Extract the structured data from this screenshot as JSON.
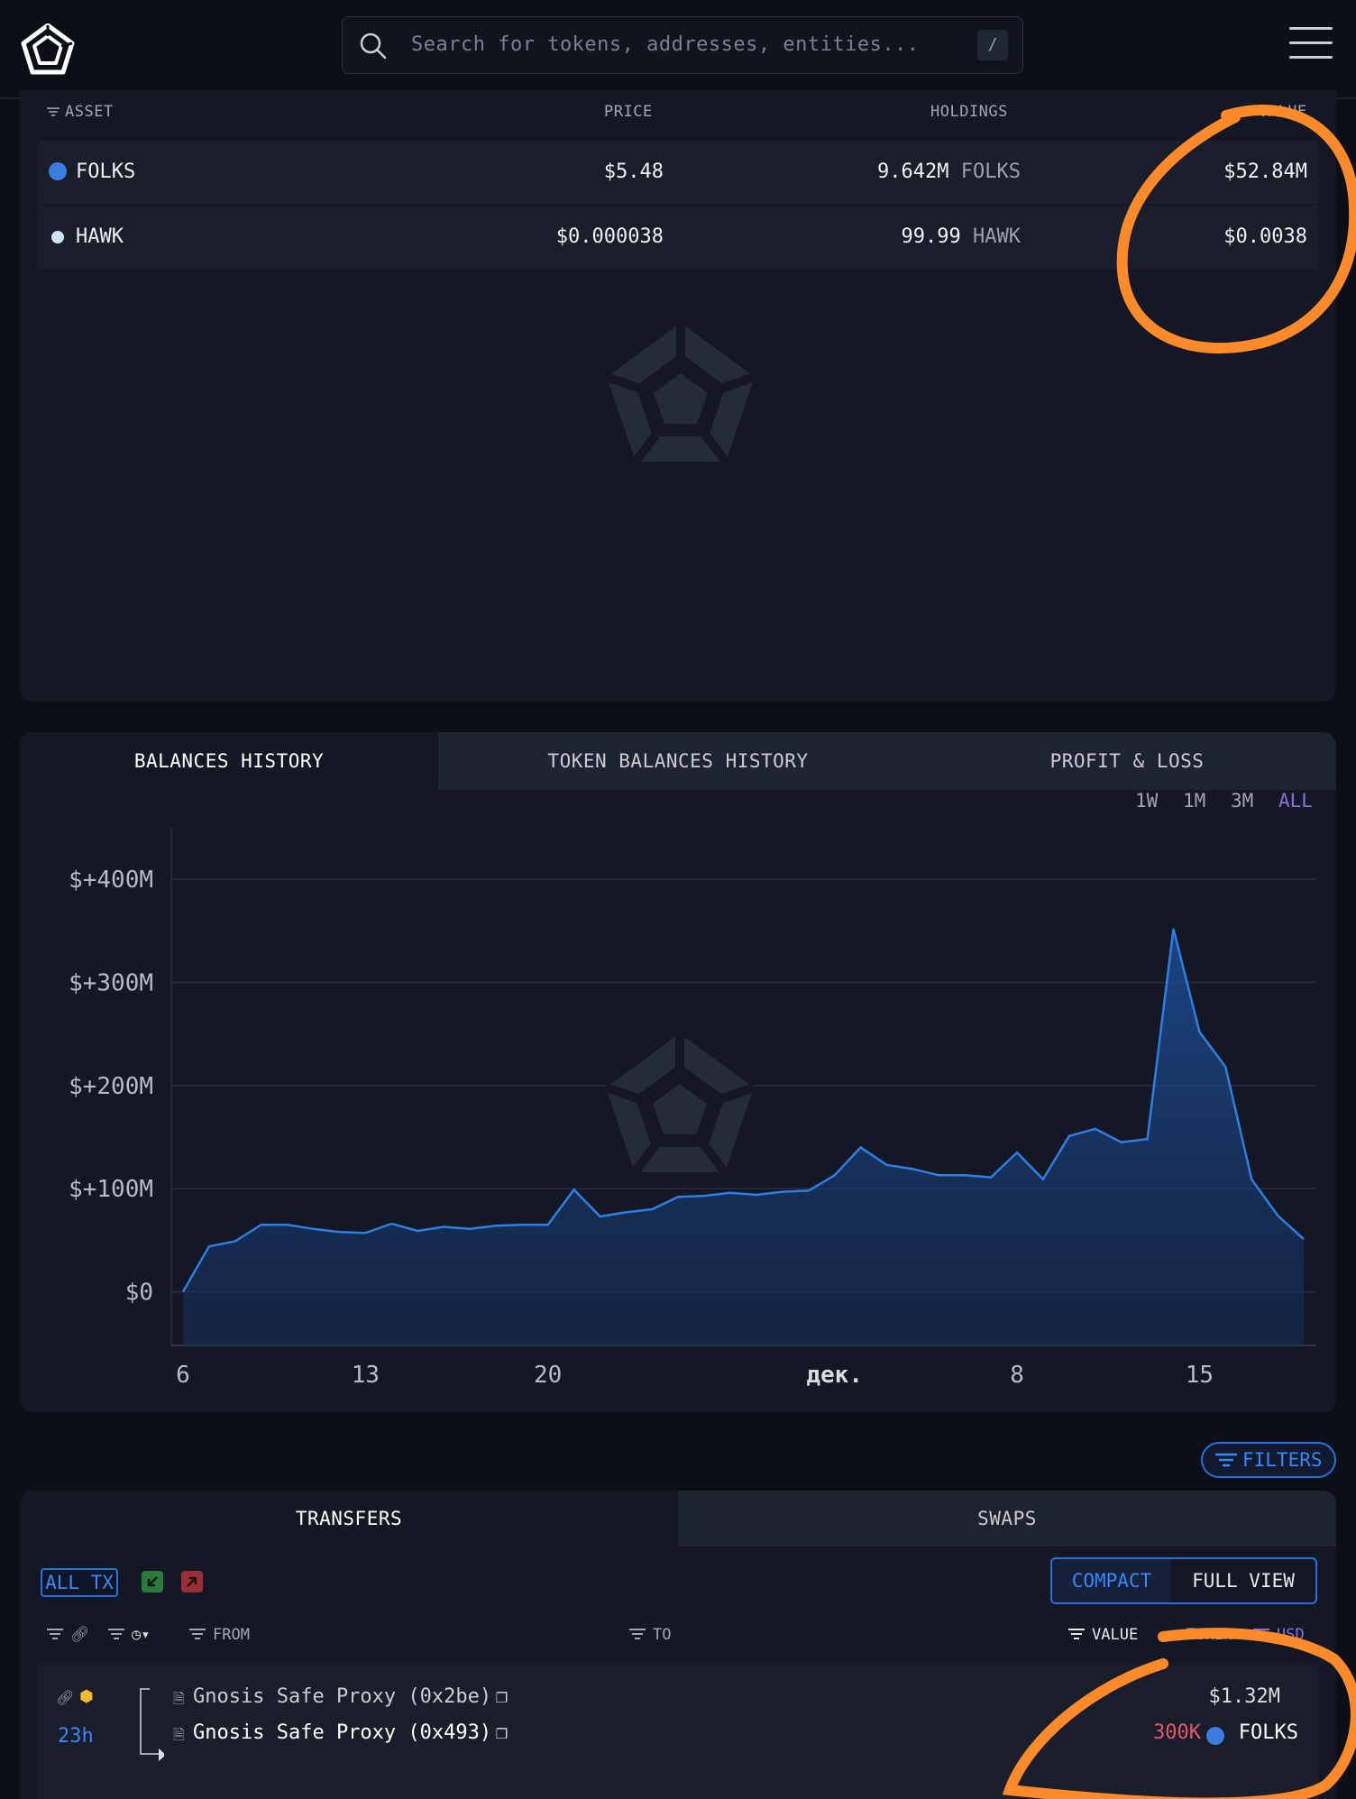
{
  "search": {
    "placeholder": "Search for tokens, addresses, entities...",
    "shortcut": "/"
  },
  "holdings": {
    "columns": {
      "asset": "ASSET",
      "price": "PRICE",
      "holdings": "HOLDINGS",
      "value": "VALUE"
    },
    "rows": [
      {
        "asset": "FOLKS",
        "price": "$5.48",
        "amount": "9.642M",
        "unit": "FOLKS",
        "value": "$52.84M",
        "color": "#3b7ddd"
      },
      {
        "asset": "HAWK",
        "price": "$0.000038",
        "amount": "99.99",
        "unit": "HAWK",
        "value": "$0.0038",
        "color": "#5aa0d8"
      }
    ]
  },
  "history": {
    "tabs": [
      "BALANCES HISTORY",
      "TOKEN BALANCES HISTORY",
      "PROFIT & LOSS"
    ],
    "ranges": [
      "1W",
      "1M",
      "3M",
      "ALL"
    ],
    "active_range": "ALL"
  },
  "chart_data": {
    "type": "area",
    "yticks": [
      "$+400M",
      "$+300M",
      "$+200M",
      "$+100M",
      "$0"
    ],
    "ylim": [
      -52,
      400
    ],
    "xticks": [
      {
        "label": "6",
        "x": 0
      },
      {
        "label": "13",
        "x": 7
      },
      {
        "label": "20",
        "x": 14
      },
      {
        "label": "дек.",
        "x": 25
      },
      {
        "label": "8",
        "x": 32
      },
      {
        "label": "15",
        "x": 39
      }
    ],
    "x": [
      0,
      1,
      2,
      3,
      4,
      5,
      6,
      7,
      8,
      9,
      10,
      11,
      12,
      13,
      14,
      15,
      16,
      17,
      18,
      19,
      20,
      21,
      22,
      23,
      24,
      25,
      26,
      27,
      28,
      29,
      30,
      31,
      32,
      33,
      34,
      35,
      36,
      37,
      38,
      39,
      40,
      41,
      42,
      43
    ],
    "values": [
      0,
      44,
      49,
      65,
      65,
      61,
      58,
      57,
      66,
      59,
      63,
      61,
      64,
      65,
      65,
      99,
      73,
      77,
      80,
      92,
      93,
      96,
      94,
      97,
      98,
      113,
      140,
      123,
      119,
      113,
      113,
      111,
      135,
      109,
      151,
      158,
      145,
      148,
      352,
      252,
      218,
      109,
      74,
      51,
      53
    ],
    "color": "#2f7fe3"
  },
  "filters_label": "FILTERS",
  "transfers": {
    "tabs": [
      "TRANSFERS",
      "SWAPS"
    ],
    "all_tx": "ALL TX",
    "view": {
      "compact": "COMPACT",
      "full": "FULL VIEW"
    },
    "columns": {
      "from": "FROM",
      "to": "TO",
      "value": "VALUE",
      "token": "TOKEN",
      "usd": "USD"
    },
    "rows": [
      {
        "time": "23h",
        "from": "Gnosis Safe Proxy (0x2be)",
        "to": "Gnosis Safe Proxy (0x493)",
        "usd": "$1.32M",
        "amount": "300K",
        "token": "FOLKS"
      }
    ]
  }
}
